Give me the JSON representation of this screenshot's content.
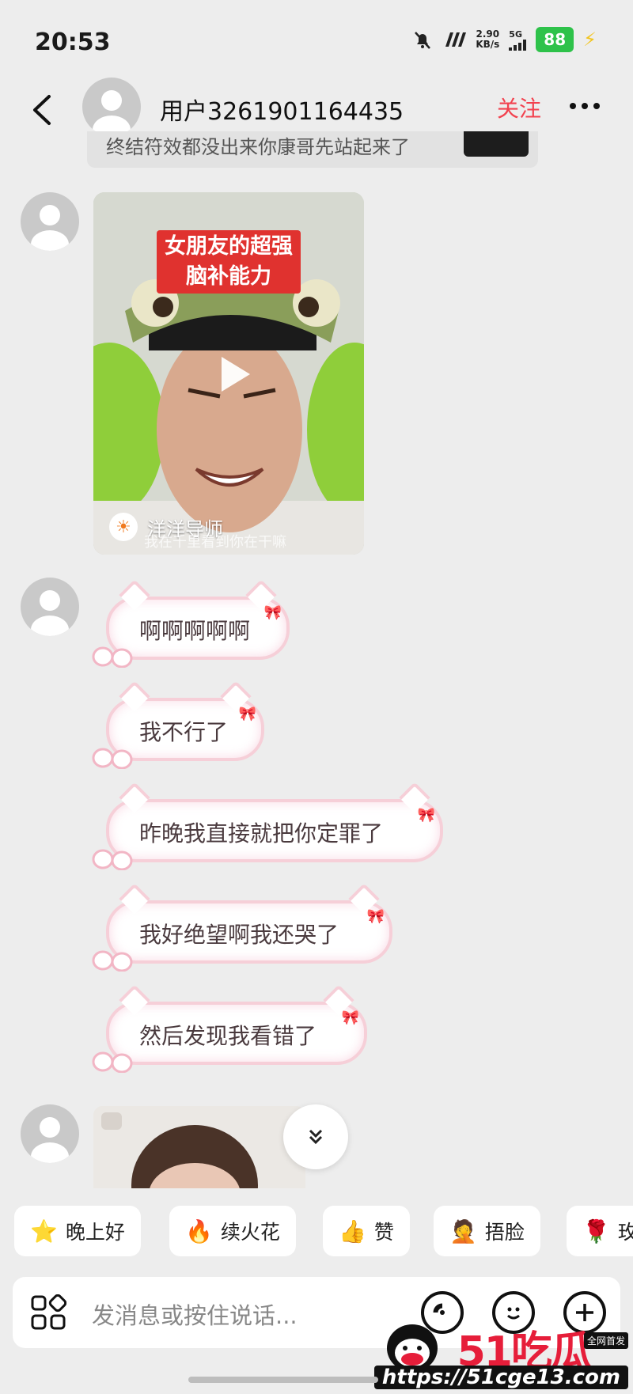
{
  "status_bar": {
    "time": "20:53",
    "net_speed": "2.90",
    "net_unit": "KB/s",
    "network": "5G",
    "battery": "88"
  },
  "header": {
    "username": "用户3261901164435",
    "follow_label": "关注"
  },
  "quote": {
    "text": "终结符效都没出来你康哥先站起来了"
  },
  "video": {
    "title_line1": "女朋友的超强",
    "title_line2": "脑补能力",
    "author": "洋洋导师",
    "subtitle": "我在千里看到你在干嘛"
  },
  "messages": [
    {
      "text": "啊啊啊啊啊"
    },
    {
      "text": "我不行了"
    },
    {
      "text": "昨晚我直接就把你定罪了"
    },
    {
      "text": "我好绝望啊我还哭了"
    },
    {
      "text": "然后发现我看错了"
    }
  ],
  "quick_replies": [
    {
      "icon": "star-face-icon",
      "label": "晚上好"
    },
    {
      "icon": "fire-icon",
      "label": "续火花"
    },
    {
      "icon": "thumbs-up-icon",
      "label": "赞"
    },
    {
      "icon": "facepalm-icon",
      "label": "捂脸"
    },
    {
      "icon": "rose-icon",
      "label": "玫"
    }
  ],
  "input": {
    "placeholder": "发消息或按住说话..."
  },
  "watermark": {
    "logo": "51吃瓜",
    "tag": "全网首发",
    "url": "https://51cge13.com"
  },
  "colors": {
    "accent": "#f2424f",
    "bubble_border": "#f6cfd8",
    "battery": "#2ec24a"
  }
}
